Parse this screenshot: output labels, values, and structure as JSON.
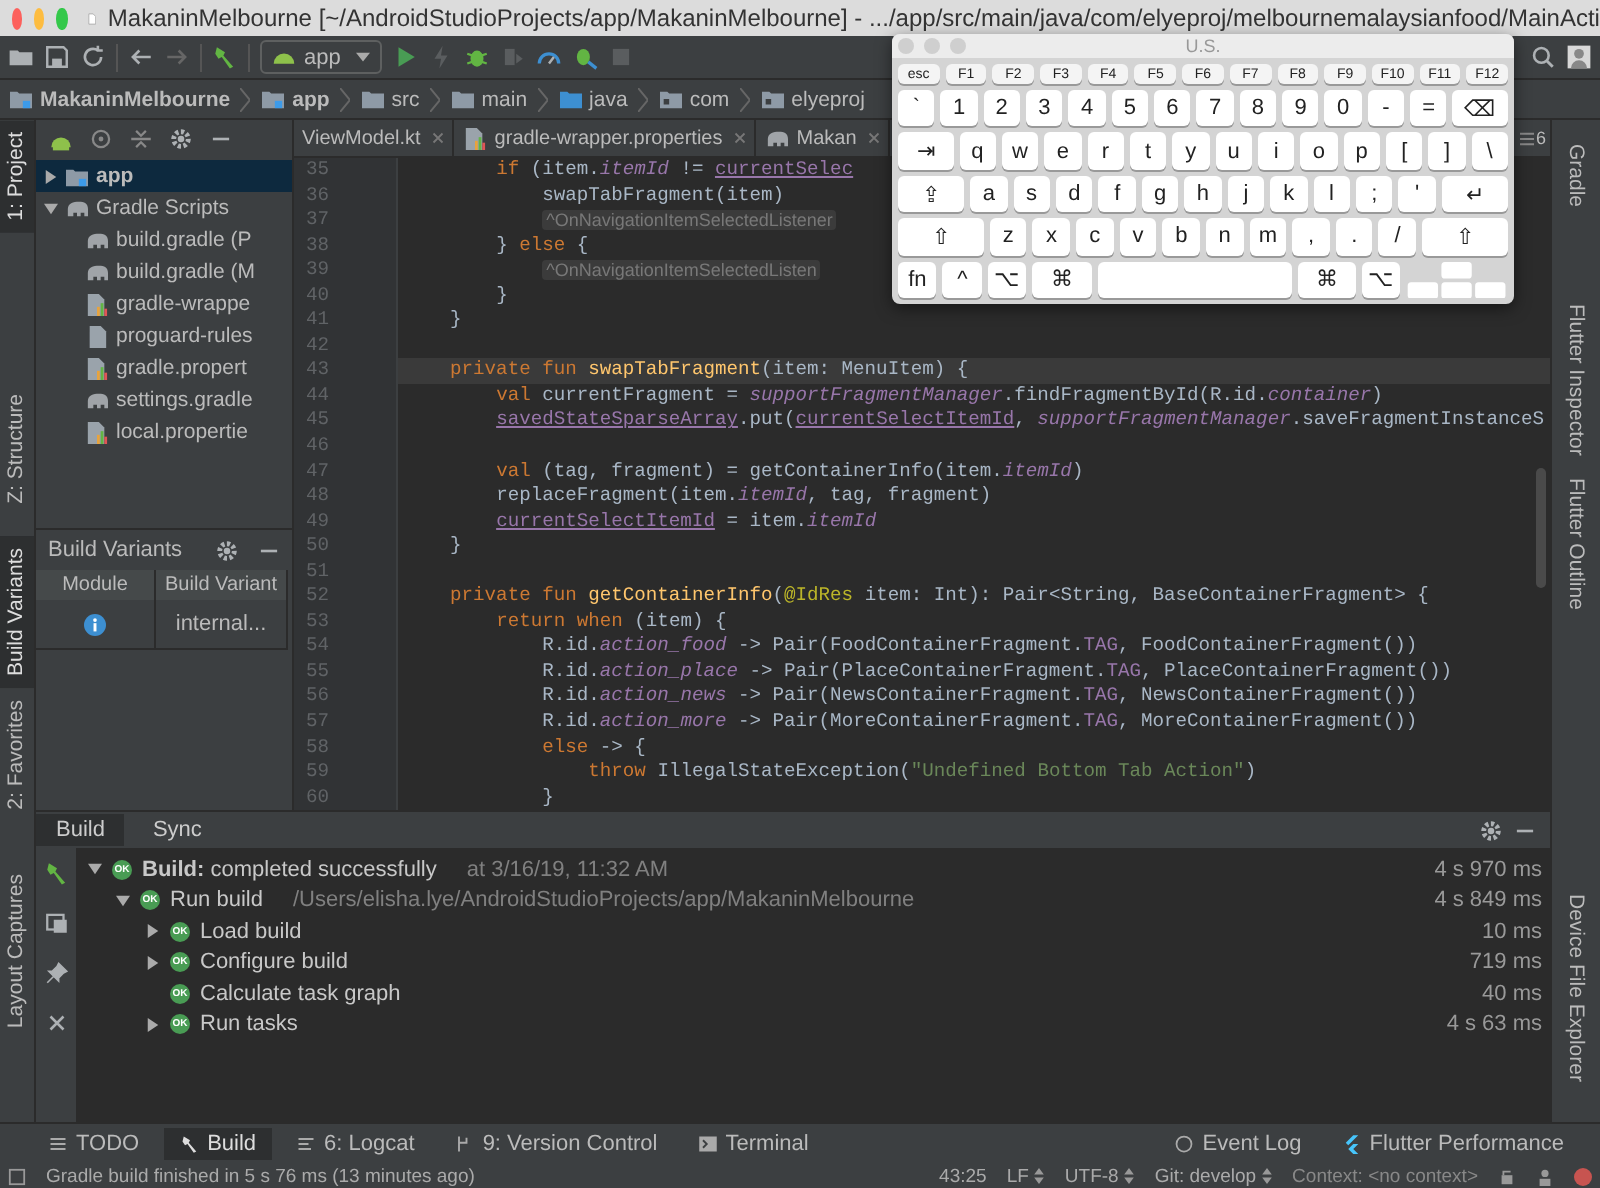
{
  "window": {
    "title": "MakaninMelbourne [~/AndroidStudioProjects/app/MakaninMelbourne] - .../app/src/main/java/com/elyeproj/melbournemalaysianfood/MainActi"
  },
  "toolbar": {
    "run_config": "app"
  },
  "breadcrumbs": [
    {
      "label": "MakaninMelbourne",
      "kind": "module"
    },
    {
      "label": "app",
      "kind": "module"
    },
    {
      "label": "src",
      "kind": "folder"
    },
    {
      "label": "main",
      "kind": "folder"
    },
    {
      "label": "java",
      "kind": "source"
    },
    {
      "label": "com",
      "kind": "package"
    },
    {
      "label": "elyeproj",
      "kind": "package"
    }
  ],
  "left_strip": [
    {
      "label": "1: Project",
      "selected": true
    },
    {
      "label": "Z: Structure",
      "selected": false
    },
    {
      "label": "Build Variants",
      "selected": true
    },
    {
      "label": "2: Favorites",
      "selected": false
    },
    {
      "label": "Layout Captures",
      "selected": false
    }
  ],
  "right_strip": [
    {
      "label": "Gradle"
    },
    {
      "label": "Flutter Inspector"
    },
    {
      "label": "Flutter Outline"
    },
    {
      "label": "Device File Explorer"
    }
  ],
  "project_tree": [
    {
      "label": "app",
      "kind": "module",
      "selected": true,
      "expanded": false
    },
    {
      "label": "Gradle Scripts",
      "kind": "gradle",
      "selected": false,
      "expanded": true,
      "children": [
        {
          "label": "build.gradle (P",
          "kind": "gradle",
          "selected": false
        },
        {
          "label": "build.gradle (M",
          "kind": "gradle",
          "selected": false
        },
        {
          "label": "gradle-wrappe",
          "kind": "properties",
          "selected": false
        },
        {
          "label": "proguard-rules",
          "kind": "file",
          "selected": false
        },
        {
          "label": "gradle.propert",
          "kind": "properties",
          "selected": false
        },
        {
          "label": "settings.gradle",
          "kind": "gradle",
          "selected": false
        },
        {
          "label": "local.propertie",
          "kind": "properties",
          "selected": false
        }
      ]
    }
  ],
  "build_variants": {
    "title": "Build Variants",
    "columns": [
      "Module",
      "Build Variant"
    ],
    "variant": "internal..."
  },
  "editor_tabs": [
    {
      "label": "ViewModel.kt",
      "selected": false
    },
    {
      "label": "gradle-wrapper.properties",
      "kind": "properties",
      "selected": false
    },
    {
      "label": "Makan",
      "kind": "gradle",
      "selected": false
    }
  ],
  "editor_tab_count": "6",
  "code_lines": [
    {
      "number": "35",
      "current": false,
      "tokens": [
        {
          "kind": "kw",
          "text": "        if"
        },
        {
          "kind": "plain",
          "text": " (item."
        },
        {
          "kind": "prop",
          "text": "itemId"
        },
        {
          "kind": "plain",
          "text": " != "
        },
        {
          "kind": "ref",
          "text": "currentSelec"
        }
      ]
    },
    {
      "number": "36",
      "current": false,
      "tokens": [
        {
          "kind": "plain",
          "text": "            swapTabFragment(item)"
        }
      ]
    },
    {
      "number": "37",
      "current": false,
      "tokens": [
        {
          "kind": "hint",
          "text": "            ^OnNavigationItemSelectedListener"
        }
      ]
    },
    {
      "number": "38",
      "current": false,
      "tokens": [
        {
          "kind": "plain",
          "text": "        } "
        },
        {
          "kind": "kw",
          "text": "else"
        },
        {
          "kind": "plain",
          "text": " {"
        }
      ]
    },
    {
      "number": "39",
      "current": false,
      "tokens": [
        {
          "kind": "hint",
          "text": "            ^OnNavigationItemSelectedListen"
        }
      ]
    },
    {
      "number": "40",
      "current": false,
      "tokens": [
        {
          "kind": "plain",
          "text": "        }"
        }
      ]
    },
    {
      "number": "41",
      "current": false,
      "tokens": [
        {
          "kind": "plain",
          "text": "    }"
        }
      ]
    },
    {
      "number": "42",
      "current": false
    },
    {
      "number": "43",
      "current": true,
      "tokens": [
        {
          "kind": "kw",
          "text": "    private fun "
        },
        {
          "kind": "fn",
          "text": "swapTabFragment"
        },
        {
          "kind": "plain",
          "text": "(item: MenuItem) {"
        }
      ]
    },
    {
      "number": "44",
      "current": false,
      "tokens": [
        {
          "kind": "kw",
          "text": "        val "
        },
        {
          "kind": "plain",
          "text": "currentFragment = "
        },
        {
          "kind": "prop",
          "text": "supportFragmentManager"
        },
        {
          "kind": "plain",
          "text": ".findFragmentById(R.id."
        },
        {
          "kind": "prop",
          "text": "container"
        },
        {
          "kind": "plain",
          "text": ")"
        }
      ]
    },
    {
      "number": "45",
      "current": false,
      "tokens": [
        {
          "kind": "ref",
          "text": "        savedStateSparseArray"
        },
        {
          "kind": "plain",
          "text": ".put("
        },
        {
          "kind": "ref",
          "text": "currentSelectItemId"
        },
        {
          "kind": "plain",
          "text": ", "
        },
        {
          "kind": "prop",
          "text": "supportFragmentManager"
        },
        {
          "kind": "plain",
          "text": ".saveFragmentInstanceS"
        }
      ]
    },
    {
      "number": "46",
      "current": false
    },
    {
      "number": "47",
      "current": false,
      "tokens": [
        {
          "kind": "kw",
          "text": "        val "
        },
        {
          "kind": "plain",
          "text": "(tag, fragment) = getContainerInfo(item."
        },
        {
          "kind": "prop",
          "text": "itemId"
        },
        {
          "kind": "plain",
          "text": ")"
        }
      ]
    },
    {
      "number": "48",
      "current": false,
      "tokens": [
        {
          "kind": "plain",
          "text": "        replaceFragment(item."
        },
        {
          "kind": "prop",
          "text": "itemId"
        },
        {
          "kind": "plain",
          "text": ", tag, fragment)"
        }
      ]
    },
    {
      "number": "49",
      "current": false,
      "tokens": [
        {
          "kind": "ref",
          "text": "        currentSelectItemId"
        },
        {
          "kind": "plain",
          "text": " = item."
        },
        {
          "kind": "prop",
          "text": "itemId"
        }
      ]
    },
    {
      "number": "50",
      "current": false,
      "tokens": [
        {
          "kind": "plain",
          "text": "    }"
        }
      ]
    },
    {
      "number": "51",
      "current": false
    },
    {
      "number": "52",
      "current": false,
      "tokens": [
        {
          "kind": "kw",
          "text": "    private fun "
        },
        {
          "kind": "fn",
          "text": "getContainerInfo"
        },
        {
          "kind": "plain",
          "text": "("
        },
        {
          "kind": "anno",
          "text": "@IdRes"
        },
        {
          "kind": "plain",
          "text": " item: Int): Pair<String, BaseContainerFragment> {"
        }
      ]
    },
    {
      "number": "53",
      "current": false,
      "tokens": [
        {
          "kind": "kw",
          "text": "        return when"
        },
        {
          "kind": "plain",
          "text": " (item) {"
        }
      ]
    },
    {
      "number": "54",
      "current": false,
      "tokens": [
        {
          "kind": "plain",
          "text": "            R.id."
        },
        {
          "kind": "prop",
          "text": "action_food"
        },
        {
          "kind": "plain",
          "text": " -> Pair(FoodContainerFragment."
        },
        {
          "kind": "field",
          "text": "TAG"
        },
        {
          "kind": "plain",
          "text": ", FoodContainerFragment())"
        }
      ]
    },
    {
      "number": "55",
      "current": false,
      "tokens": [
        {
          "kind": "plain",
          "text": "            R.id."
        },
        {
          "kind": "prop",
          "text": "action_place"
        },
        {
          "kind": "plain",
          "text": " -> Pair(PlaceContainerFragment."
        },
        {
          "kind": "field",
          "text": "TAG"
        },
        {
          "kind": "plain",
          "text": ", PlaceContainerFragment())"
        }
      ]
    },
    {
      "number": "56",
      "current": false,
      "tokens": [
        {
          "kind": "plain",
          "text": "            R.id."
        },
        {
          "kind": "prop",
          "text": "action_news"
        },
        {
          "kind": "plain",
          "text": " -> Pair(NewsContainerFragment."
        },
        {
          "kind": "field",
          "text": "TAG"
        },
        {
          "kind": "plain",
          "text": ", NewsContainerFragment())"
        }
      ]
    },
    {
      "number": "57",
      "current": false,
      "tokens": [
        {
          "kind": "plain",
          "text": "            R.id."
        },
        {
          "kind": "prop",
          "text": "action_more"
        },
        {
          "kind": "plain",
          "text": " -> Pair(MoreContainerFragment."
        },
        {
          "kind": "field",
          "text": "TAG"
        },
        {
          "kind": "plain",
          "text": ", MoreContainerFragment())"
        }
      ]
    },
    {
      "number": "58",
      "current": false,
      "tokens": [
        {
          "kind": "kw",
          "text": "            else"
        },
        {
          "kind": "plain",
          "text": " -> {"
        }
      ]
    },
    {
      "number": "59",
      "current": false,
      "tokens": [
        {
          "kind": "kw",
          "text": "                throw"
        },
        {
          "kind": "plain",
          "text": " IllegalStateException("
        },
        {
          "kind": "str",
          "text": "\"Undefined Bottom Tab Action\""
        },
        {
          "kind": "plain",
          "text": ")"
        }
      ]
    },
    {
      "number": "60",
      "current": false,
      "tokens": [
        {
          "kind": "plain",
          "text": "            }"
        }
      ]
    }
  ],
  "keyboard": {
    "title": "U.S.",
    "rows": [
      [
        {
          "label": "esc",
          "kind": "fkey"
        },
        {
          "label": "F1",
          "kind": "fkey"
        },
        {
          "label": "F2",
          "kind": "fkey"
        },
        {
          "label": "F3",
          "kind": "fkey"
        },
        {
          "label": "F4",
          "kind": "fkey"
        },
        {
          "label": "F5",
          "kind": "fkey"
        },
        {
          "label": "F6",
          "kind": "fkey"
        },
        {
          "label": "F7",
          "kind": "fkey"
        },
        {
          "label": "F8",
          "kind": "fkey"
        },
        {
          "label": "F9",
          "kind": "fkey"
        },
        {
          "label": "F10",
          "kind": "fkey"
        },
        {
          "label": "F11",
          "kind": "fkey"
        },
        {
          "label": "F12",
          "kind": "fkey"
        }
      ],
      [
        {
          "label": "`",
          "kind": "key"
        },
        {
          "label": "1",
          "kind": "key"
        },
        {
          "label": "2",
          "kind": "key"
        },
        {
          "label": "3",
          "kind": "key"
        },
        {
          "label": "4",
          "kind": "key"
        },
        {
          "label": "5",
          "kind": "key"
        },
        {
          "label": "6",
          "kind": "key"
        },
        {
          "label": "7",
          "kind": "key"
        },
        {
          "label": "8",
          "kind": "key"
        },
        {
          "label": "9",
          "kind": "key"
        },
        {
          "label": "0",
          "kind": "key"
        },
        {
          "label": "-",
          "kind": "key"
        },
        {
          "label": "=",
          "kind": "key"
        },
        {
          "label": "⌫",
          "kind": "wide"
        }
      ],
      [
        {
          "label": "⇥",
          "kind": "wide"
        },
        {
          "label": "q",
          "kind": "key"
        },
        {
          "label": "w",
          "kind": "key"
        },
        {
          "label": "e",
          "kind": "key"
        },
        {
          "label": "r",
          "kind": "key"
        },
        {
          "label": "t",
          "kind": "key"
        },
        {
          "label": "y",
          "kind": "key"
        },
        {
          "label": "u",
          "kind": "key"
        },
        {
          "label": "i",
          "kind": "key"
        },
        {
          "label": "o",
          "kind": "key"
        },
        {
          "label": "p",
          "kind": "key"
        },
        {
          "label": "[",
          "kind": "key"
        },
        {
          "label": "]",
          "kind": "key"
        },
        {
          "label": "\\",
          "kind": "key"
        }
      ],
      [
        {
          "label": "⇪",
          "kind": "caps"
        },
        {
          "label": "a",
          "kind": "key"
        },
        {
          "label": "s",
          "kind": "key"
        },
        {
          "label": "d",
          "kind": "key"
        },
        {
          "label": "f",
          "kind": "key"
        },
        {
          "label": "g",
          "kind": "key"
        },
        {
          "label": "h",
          "kind": "key"
        },
        {
          "label": "j",
          "kind": "key"
        },
        {
          "label": "k",
          "kind": "key"
        },
        {
          "label": "l",
          "kind": "key"
        },
        {
          "label": ";",
          "kind": "key"
        },
        {
          "label": "'",
          "kind": "key"
        },
        {
          "label": "↵",
          "kind": "caps"
        }
      ],
      [
        {
          "label": "⇧",
          "kind": "shift"
        },
        {
          "label": "z",
          "kind": "key"
        },
        {
          "label": "x",
          "kind": "key"
        },
        {
          "label": "c",
          "kind": "key"
        },
        {
          "label": "v",
          "kind": "key"
        },
        {
          "label": "b",
          "kind": "key"
        },
        {
          "label": "n",
          "kind": "key"
        },
        {
          "label": "m",
          "kind": "key"
        },
        {
          "label": ",",
          "kind": "key"
        },
        {
          "label": ".",
          "kind": "key"
        },
        {
          "label": "/",
          "kind": "key"
        },
        {
          "label": "⇧",
          "kind": "shift"
        }
      ],
      [
        {
          "label": "fn",
          "kind": "key"
        },
        {
          "label": "^",
          "kind": "key"
        },
        {
          "label": "⌥",
          "kind": "key"
        },
        {
          "label": "⌘",
          "kind": "wide"
        },
        {
          "kind": "space"
        },
        {
          "label": "⌘",
          "kind": "wide"
        },
        {
          "label": "⌥",
          "kind": "key"
        },
        {
          "kind": "arrows"
        }
      ]
    ]
  },
  "build_panel": {
    "tabs": [
      {
        "label": "Build",
        "selected": true
      },
      {
        "label": "Sync",
        "selected": false
      }
    ],
    "tree": [
      {
        "label": "**Build:** completed successfully",
        "detail": "at 3/16/19, 11:32 AM",
        "status": "OK",
        "time": "4 s 970 ms",
        "kind": "group",
        "expanded": true,
        "children": [
          {
            "label": "Run build",
            "detail": "/Users/elisha.lye/AndroidStudioProjects/app/MakaninMelbourne",
            "status": "OK",
            "time": "4 s 849 ms",
            "kind": "group",
            "expanded": true,
            "children": [
              {
                "label": "Load build",
                "status": "OK",
                "time": "10 ms",
                "kind": "group",
                "expanded": false
              },
              {
                "label": "Configure build",
                "status": "OK",
                "time": "719 ms",
                "kind": "group",
                "expanded": false
              },
              {
                "label": "Calculate task graph",
                "status": "OK",
                "time": "40 ms",
                "kind": "leaf"
              },
              {
                "label": "Run tasks",
                "status": "OK",
                "time": "4 s 63 ms",
                "kind": "group",
                "expanded": false
              }
            ]
          }
        ]
      }
    ]
  },
  "tool_windows": [
    {
      "label": "TODO",
      "kind": "list",
      "selected": false
    },
    {
      "label": "Build",
      "kind": "hammer",
      "selected": true
    },
    {
      "label": "6: Logcat",
      "kind": "log",
      "selected": false
    },
    {
      "label": "9: Version Control",
      "kind": "vcs",
      "selected": false
    },
    {
      "label": "Terminal",
      "kind": "terminal",
      "selected": false
    }
  ],
  "tool_windows_right": [
    {
      "label": "Event Log",
      "kind": "bubble"
    },
    {
      "label": "Flutter Performance",
      "kind": "flutter"
    }
  ],
  "status_bar": {
    "message": "Gradle build finished in 5 s 76 ms (13 minutes ago)",
    "position": "43:25",
    "line_ending": "LF",
    "encoding": "UTF-8",
    "branch": "Git: develop",
    "context": "Context: <no context>"
  }
}
